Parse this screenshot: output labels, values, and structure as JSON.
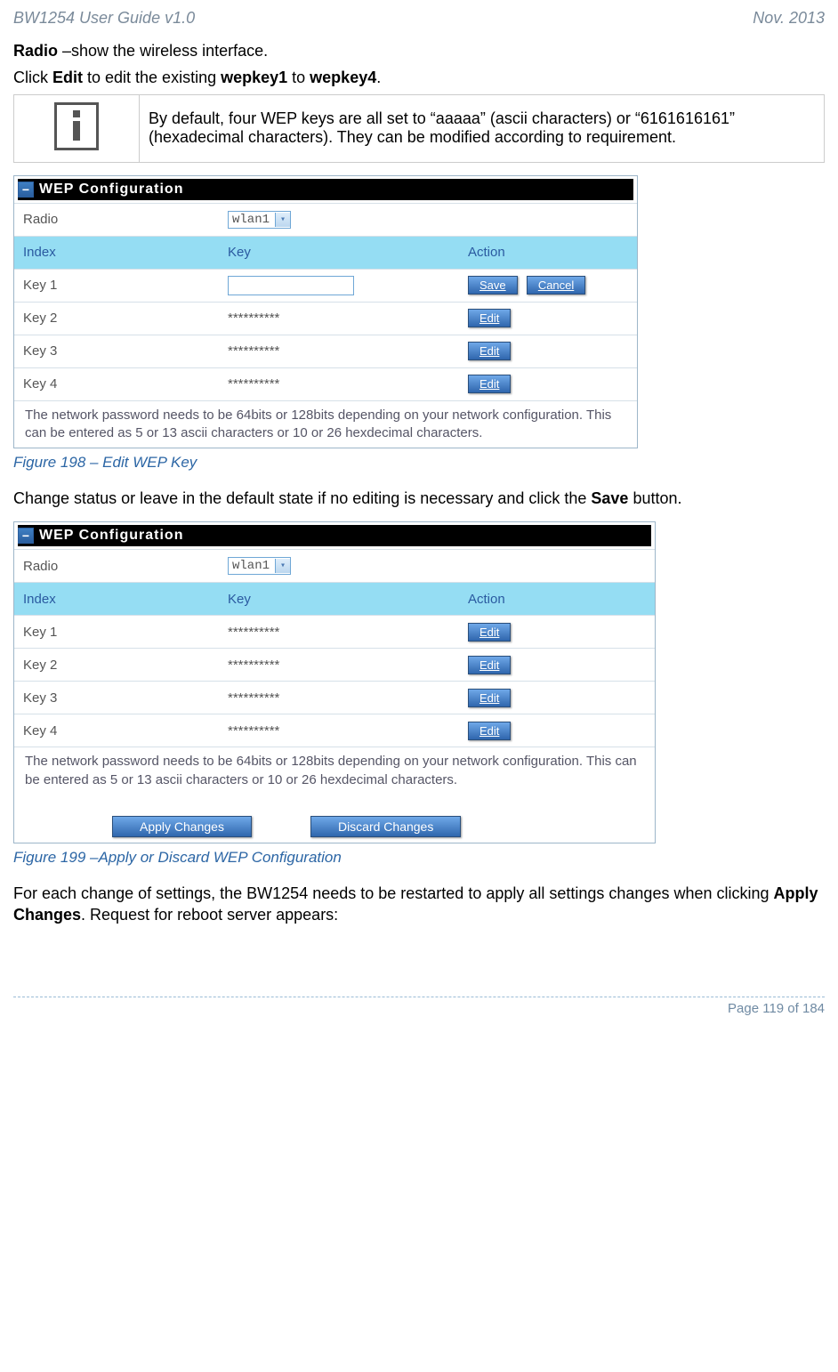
{
  "header": {
    "left": "BW1254 User Guide v1.0",
    "right": "Nov.  2013"
  },
  "intro": {
    "radio_label": "Radio",
    "radio_desc": " –show the wireless interface.",
    "edit_sentence_prefix": "Click ",
    "edit_word": "Edit",
    "edit_sentence_mid": " to edit the existing ",
    "wep1": "wepkey1",
    "to_word": " to ",
    "wep4": "wepkey4",
    "period": "."
  },
  "info_note": "By default, four WEP keys are all set to “aaaaa” (ascii characters) or “6161616161” (hexadecimal characters). They can be modified according to requirement.",
  "fig1": {
    "title": "WEP Configuration",
    "radio_label": "Radio",
    "radio_value": "wlan1",
    "cols": {
      "index": "Index",
      "key": "Key",
      "action": "Action"
    },
    "rows": [
      {
        "index": "Key 1",
        "key": "",
        "save": "Save",
        "cancel": "Cancel"
      },
      {
        "index": "Key 2",
        "key": "**********",
        "edit": "Edit"
      },
      {
        "index": "Key 3",
        "key": "**********",
        "edit": "Edit"
      },
      {
        "index": "Key 4",
        "key": "**********",
        "edit": "Edit"
      }
    ],
    "note": "The network password needs to be 64bits or 128bits depending on your network configuration. This can be entered as 5 or 13 ascii characters or 10 or 26 hexdecimal characters."
  },
  "caption1": "Figure 198 – Edit WEP Key",
  "mid_text_prefix": "Change status or leave in the default state if no editing is necessary and click the ",
  "mid_text_save": "Save",
  "mid_text_suffix": " button.",
  "fig2": {
    "title": "WEP Configuration",
    "radio_label": "Radio",
    "radio_value": "wlan1",
    "cols": {
      "index": "Index",
      "key": "Key",
      "action": "Action"
    },
    "rows": [
      {
        "index": "Key 1",
        "key": "**********",
        "edit": "Edit"
      },
      {
        "index": "Key 2",
        "key": "**********",
        "edit": "Edit"
      },
      {
        "index": "Key 3",
        "key": "**********",
        "edit": "Edit"
      },
      {
        "index": "Key 4",
        "key": "**********",
        "edit": "Edit"
      }
    ],
    "note": "The network password needs to be 64bits or 128bits depending on your network configuration. This can be entered as 5 or 13 ascii characters or 10 or 26 hexdecimal characters.",
    "apply": "Apply Changes",
    "discard": "Discard Changes"
  },
  "caption2": "Figure 199 –Apply or Discard WEP Configuration",
  "closing_prefix": "For each change of settings, the BW1254 needs to be restarted to apply all settings changes when clicking ",
  "closing_bold": "Apply Changes",
  "closing_suffix": ". Request for reboot server appears:",
  "footer": "Page 119 of 184"
}
